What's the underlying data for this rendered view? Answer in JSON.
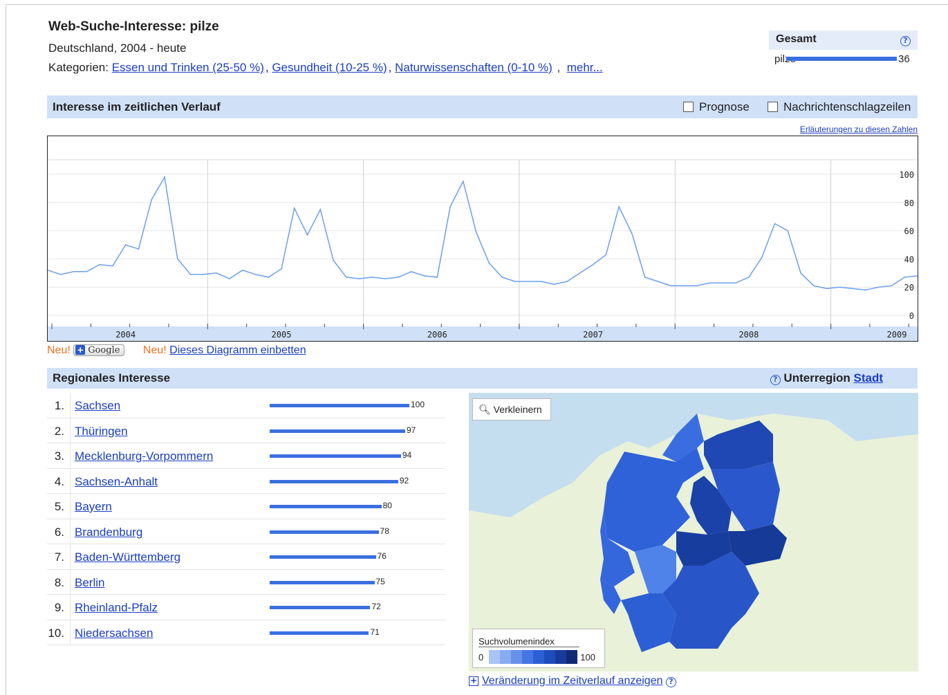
{
  "header": {
    "title": "Web-Suche-Interesse: pilze",
    "subtitle": "Deutschland, 2004 - heute",
    "categories_label": "Kategorien:",
    "categories": [
      "Essen und Trinken (25-50 %)",
      "Gesundheit (10-25 %)",
      "Naturwissenschaften (0-10 %)"
    ],
    "more_link": "mehr..."
  },
  "gesamt": {
    "title": "Gesamt",
    "term": "pilze",
    "value": "36"
  },
  "timeline": {
    "section_title": "Interesse im zeitlichen Verlauf",
    "checkbox_prognose": "Prognose",
    "checkbox_news": "Nachrichtenschlagzeilen",
    "explain_link": "Erläuterungen zu diesen Zahlen"
  },
  "chart_data": {
    "type": "line",
    "title": "",
    "xlabel": "",
    "ylabel": "",
    "ylim": [
      0,
      108
    ],
    "y_ticks": [
      0,
      20,
      40,
      60,
      80,
      100
    ],
    "x_tick_labels": [
      "2004",
      "2005",
      "2006",
      "2007",
      "2008",
      "2009"
    ],
    "grid": true,
    "color": "#6a9ff0",
    "series": [
      {
        "values": [
          32,
          29,
          31,
          31,
          36,
          35,
          50,
          47,
          82,
          98,
          40,
          29,
          29,
          30,
          26,
          32,
          29,
          27,
          33,
          76,
          57,
          75,
          39,
          27,
          26,
          27,
          26,
          27,
          31,
          28,
          27,
          77,
          95,
          59,
          37,
          27,
          24,
          24,
          24,
          22,
          24,
          30,
          36,
          43,
          77,
          58,
          27,
          24,
          21,
          21,
          21,
          23,
          23,
          23,
          27,
          41,
          65,
          60,
          30,
          21,
          19,
          20,
          19,
          18,
          20,
          21,
          27,
          28
        ]
      }
    ]
  },
  "embed": {
    "neu1": "Neu!",
    "google_btn": "Google",
    "neu2": "Neu!",
    "embed_link": "Dieses Diagramm einbetten"
  },
  "regional": {
    "section_title": "Regionales Interesse",
    "subregion_label": "Unterregion",
    "city_link": "Stadt",
    "items": [
      {
        "rank": "1.",
        "name": "Sachsen",
        "value": 100
      },
      {
        "rank": "2.",
        "name": "Thüringen",
        "value": 97
      },
      {
        "rank": "3.",
        "name": "Mecklenburg-Vorpommern",
        "value": 94
      },
      {
        "rank": "4.",
        "name": "Sachsen-Anhalt",
        "value": 92
      },
      {
        "rank": "5.",
        "name": "Bayern",
        "value": 80
      },
      {
        "rank": "6.",
        "name": "Brandenburg",
        "value": 78
      },
      {
        "rank": "7.",
        "name": "Baden-Württemberg",
        "value": 76
      },
      {
        "rank": "8.",
        "name": "Berlin",
        "value": 75
      },
      {
        "rank": "9.",
        "name": "Rheinland-Pfalz",
        "value": 72
      },
      {
        "rank": "10.",
        "name": "Niedersachsen",
        "value": 71
      }
    ]
  },
  "map": {
    "zoom_button": "Verkleinern",
    "legend_title": "Suchvolumenindex",
    "legend_min": "0",
    "legend_max": "100",
    "legend_colors": [
      "#a9c5f5",
      "#88acf0",
      "#6591ea",
      "#4576e2",
      "#2c5fd6",
      "#1f4cbd",
      "#173b9a",
      "#102b73"
    ],
    "change_link": "Veränderung im Zeitverlauf anzeigen"
  }
}
